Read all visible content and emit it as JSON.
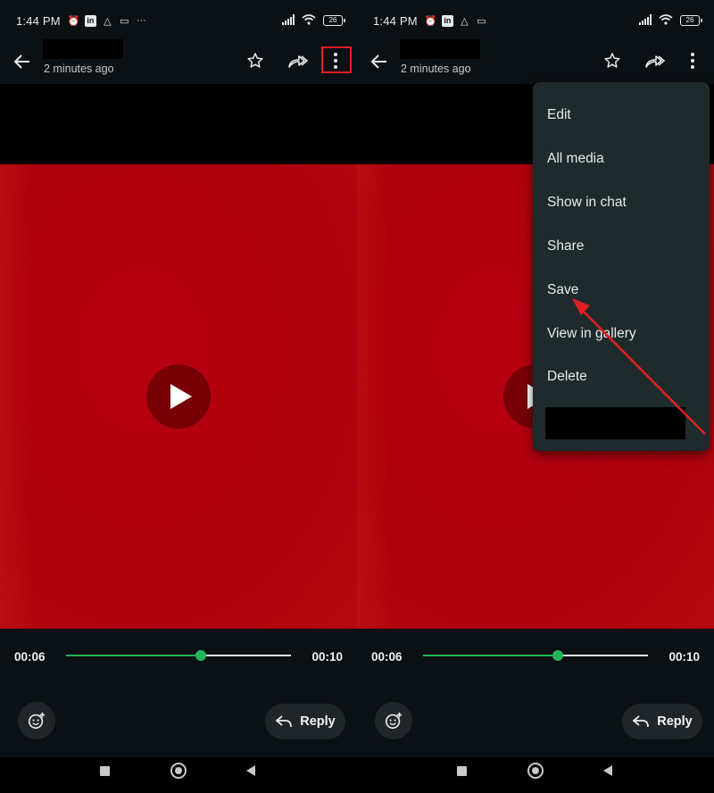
{
  "status_bar": {
    "time": "1:44 PM",
    "battery": "26",
    "more": "···"
  },
  "header": {
    "subtitle": "2 minutes ago"
  },
  "player": {
    "current_time": "00:06",
    "duration": "00:10",
    "progress": 0.6
  },
  "bottom": {
    "reply_label": "Reply"
  },
  "menu": {
    "items": [
      "Edit",
      "All media",
      "Show in chat",
      "Share",
      "Save",
      "View in gallery",
      "Delete"
    ]
  },
  "annotation": {
    "highlight_color": "#e02020",
    "arrow_color": "#e02020"
  },
  "colors": {
    "accent": "#23b45a",
    "video": "#b0000e",
    "menu_bg": "#1f2a2d"
  }
}
